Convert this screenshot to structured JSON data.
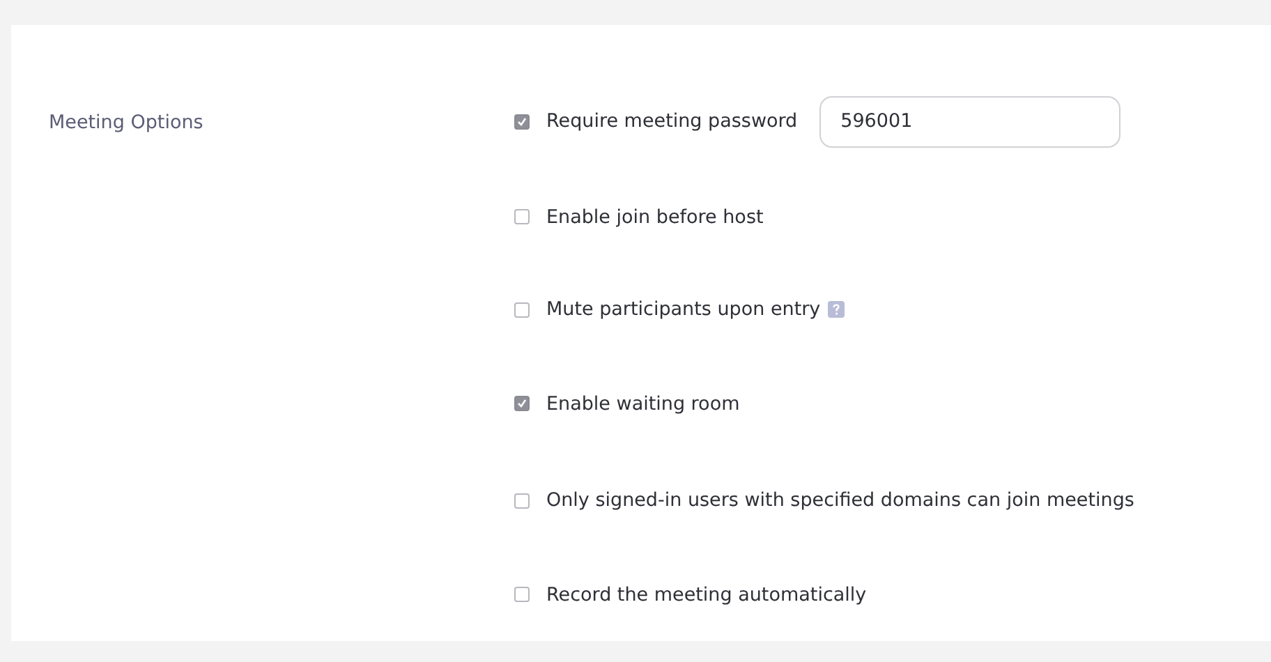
{
  "section": {
    "label": "Meeting Options"
  },
  "options": [
    {
      "kind": "password",
      "label": "Require meeting password",
      "checked": true,
      "value": "596001"
    },
    {
      "kind": "checkbox",
      "label": "Enable join before host",
      "checked": false
    },
    {
      "kind": "checkbox",
      "label": "Mute participants upon entry",
      "checked": false,
      "help": true
    },
    {
      "kind": "checkbox",
      "label": "Enable waiting room",
      "checked": true
    },
    {
      "kind": "checkbox",
      "label": "Only signed-in users with specified domains can join meetings",
      "checked": false
    },
    {
      "kind": "checkbox",
      "label": "Record the meeting automatically",
      "checked": false
    }
  ]
}
